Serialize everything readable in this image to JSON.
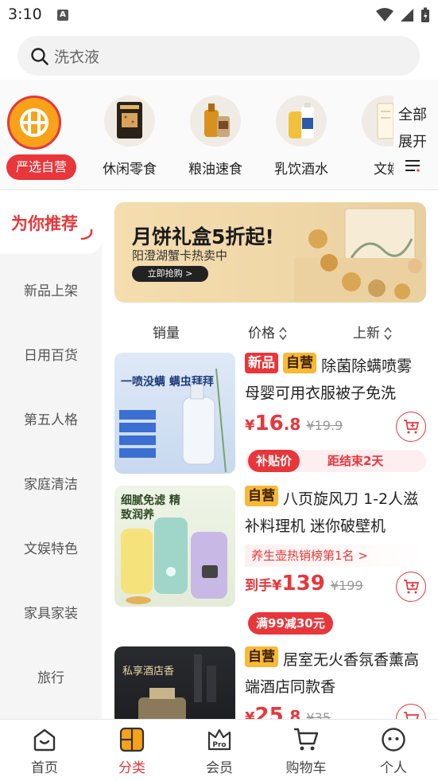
{
  "status_bar": {
    "time": "3:10",
    "notif_icon": "A"
  },
  "search": {
    "placeholder": "洗衣液"
  },
  "categories": [
    {
      "label": "严选自营",
      "icon": "yanxuan-logo-icon"
    },
    {
      "label": "休闲零食",
      "icon": "snack-icon"
    },
    {
      "label": "粮油速食",
      "icon": "grain-oil-icon"
    },
    {
      "label": "乳饮酒水",
      "icon": "drinks-icon"
    },
    {
      "label": "文娱",
      "icon": "stationery-icon"
    }
  ],
  "all_expand": {
    "line1": "全部",
    "line2": "展开"
  },
  "left_nav": {
    "active": "为你推荐",
    "items": [
      "新品上架",
      "日用百货",
      "第五人格",
      "家庭清洁",
      "文娱特色",
      "家具家装",
      "旅行"
    ]
  },
  "banner": {
    "title": "月饼礼盒5折起!",
    "subtitle": "阳澄湖蟹卡热卖中",
    "button": "立即抢购 >"
  },
  "sort": {
    "sales": "销量",
    "price": "价格",
    "newest": "上新"
  },
  "products": [
    {
      "tags": [
        "新品",
        "自营"
      ],
      "title": "除菌除螨喷雾母婴可用衣服被子免洗",
      "currency": "¥",
      "price_int": "16",
      "price_dec": ".8",
      "original_price": "¥19.9",
      "promo_tag": "补贴价",
      "promo_text": "距结束2天",
      "thumb_text": "一喷没螨 螨虫拜拜"
    },
    {
      "tags": [
        "自营"
      ],
      "title": "八页旋风刀 1-2人滋补料理机 迷你破壁机",
      "rank_text": "养生壶热销榜第1名 >",
      "price_prefix": "到手",
      "currency": "¥",
      "price_int": "139",
      "original_price": "¥199",
      "promo_tag": "满99减30元",
      "thumb_text": "细腻免滤 精致润养"
    },
    {
      "tags": [
        "自营"
      ],
      "title": "居室无火香氛香薰高端酒店同款香",
      "currency": "¥",
      "price_int": "25",
      "price_dec": ".8",
      "original_price": "¥35",
      "thumb_text": "私享酒店香"
    }
  ],
  "bottom_nav": [
    {
      "label": "首页",
      "icon": "home-icon"
    },
    {
      "label": "分类",
      "icon": "category-icon",
      "active": true
    },
    {
      "label": "会员",
      "icon": "pro-member-icon"
    },
    {
      "label": "购物车",
      "icon": "cart-icon"
    },
    {
      "label": "个人",
      "icon": "profile-icon"
    }
  ],
  "colors": {
    "accent": "#e8363a",
    "self_tag": "#f8b936",
    "active_cat_bg": "#f8a21a"
  }
}
